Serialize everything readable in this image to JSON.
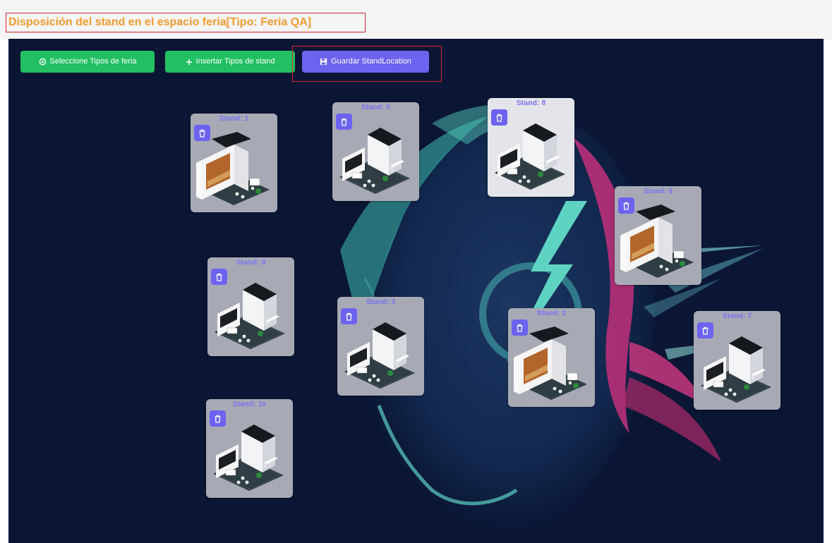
{
  "header": {
    "title": "Disposición del stand en el espacio feria[Tipo: Feria QA]"
  },
  "toolbar": {
    "select_fair_types": {
      "label": "Seleccione Tipos de feria",
      "icon": "circle-dot-icon"
    },
    "insert_stand_types": {
      "label": "Insertar Tipos de stand",
      "icon": "plus-icon"
    },
    "save_location": {
      "label": "Guardar StandLocation",
      "icon": "floppy-disk-icon"
    }
  },
  "stands": [
    {
      "label": "Stand: 1",
      "variant": "large"
    },
    {
      "label": "Stand: 5",
      "variant": "small"
    },
    {
      "label": "Stand: 8",
      "variant": "small"
    },
    {
      "label": "Stand: 6",
      "variant": "large"
    },
    {
      "label": "Stand: 9",
      "variant": "small"
    },
    {
      "label": "Stand: 3",
      "variant": "small"
    },
    {
      "label": "Stand: 2",
      "variant": "large"
    },
    {
      "label": "Stand: 7",
      "variant": "small"
    },
    {
      "label": "Stand: 10",
      "variant": "small"
    }
  ],
  "colors": {
    "canvas_bg": "#0a1633",
    "green_button": "#22c063",
    "purple_button": "#6c63f0",
    "title_text": "#f39a2d",
    "highlight_border": "#d9232e",
    "stand_label": "#7b73ee"
  }
}
